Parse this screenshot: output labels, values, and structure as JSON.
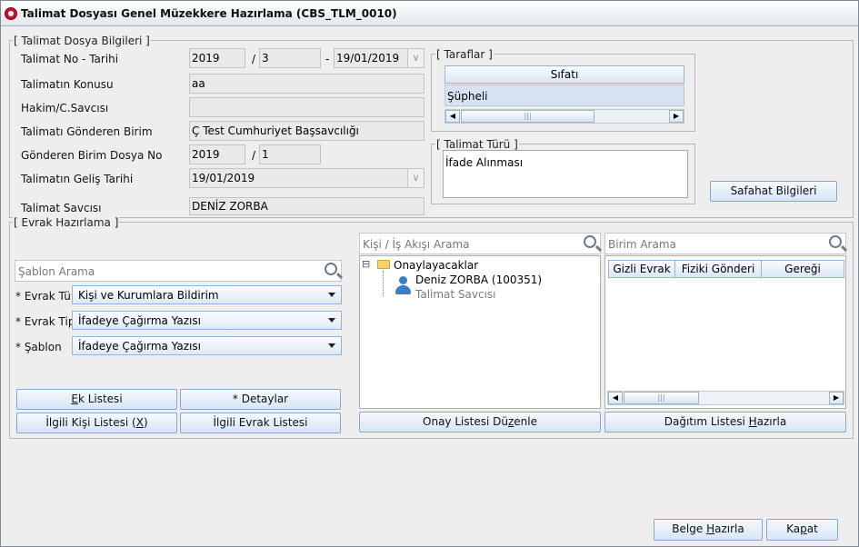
{
  "window": {
    "title": "Talimat Dosyası Genel Müzekkere Hazırlama (CBS_TLM_0010)"
  },
  "talimat_dosya": {
    "legend": "[ Talimat Dosya Bilgileri ]",
    "no_tarihi": {
      "label": "Talimat No - Tarihi",
      "year": "2019",
      "sep1": "/",
      "no": "3",
      "sep2": "-",
      "date": "19/01/2019"
    },
    "konusu": {
      "label": "Talimatın Konusu",
      "value": "aa"
    },
    "hakim": {
      "label": "Hakim/C.Savcısı",
      "value": ""
    },
    "gonderen_birim": {
      "label": "Talimatı Gönderen Birim",
      "value": "Ç Test Cumhuriyet Başsavcılığı"
    },
    "gonderen_dosya": {
      "label": "Gönderen Birim Dosya No",
      "year": "2019",
      "sep": "/",
      "no": "1"
    },
    "gelis_tarihi": {
      "label": "Talimatın Geliş Tarihi",
      "value": "19/01/2019"
    },
    "savcisi": {
      "label": "Talimat Savcısı",
      "value": "DENİZ  ZORBA"
    }
  },
  "taraflar": {
    "legend": "[ Taraflar ]",
    "column": "Sıfatı",
    "rows": [
      "Şüpheli"
    ]
  },
  "talimat_turu": {
    "legend": "[ Talimat Türü ]",
    "value": "İfade Alınması"
  },
  "safahat_button": "Safahat Bilgileri",
  "evrak": {
    "legend": "[ Evrak Hazırlama ]",
    "sablon_search_placeholder": "Şablon Arama",
    "evrak_turu": {
      "label": "* Evrak Türü",
      "value": "Kişi ve Kurumlara Bildirim"
    },
    "evrak_tipi": {
      "label": "* Evrak Tipi",
      "value": "İfadeye Çağırma Yazısı"
    },
    "sablon": {
      "label": "* Şablon",
      "value": "İfadeye Çağırma Yazısı"
    },
    "buttons": {
      "ek_listesi_pre": "",
      "ek_listesi_u": "E",
      "ek_listesi_post": "k Listesi",
      "detaylar": "* Detaylar",
      "ilgili_kisi_pre": "İlgili Kişi Listesi (",
      "ilgili_kisi_u": "X",
      "ilgili_kisi_post": ")",
      "ilgili_evrak": "İlgili Evrak Listesi"
    }
  },
  "kisi_is_akisi": {
    "search_placeholder": "Kişi / İş Akışı Arama",
    "tree_root": "Onaylayacaklar",
    "tree_minus": "⊟",
    "person_name": "Deniz ZORBA (100351)",
    "person_role": "Talimat Savcısı",
    "onay_button_pre": "Onay Listesi Dü",
    "onay_button_u": "z",
    "onay_button_post": "enle"
  },
  "birim_arama": {
    "search_placeholder": "Birim Arama",
    "columns": [
      "Gizli Evrak",
      "Fiziki Gönderi",
      "Gereği"
    ],
    "dagitim_button_pre": "Dağıtım Listesi ",
    "dagitim_button_u": "H",
    "dagitim_button_post": "azırla"
  },
  "footer": {
    "belge_pre": "Belge ",
    "belge_u": "H",
    "belge_post": "azırla",
    "kapat_pre": "Ka",
    "kapat_u": "p",
    "kapat_post": "at"
  },
  "scroll": {
    "left": "◀",
    "right": "▶",
    "grip": "|||"
  },
  "dd_arrow": "∨"
}
